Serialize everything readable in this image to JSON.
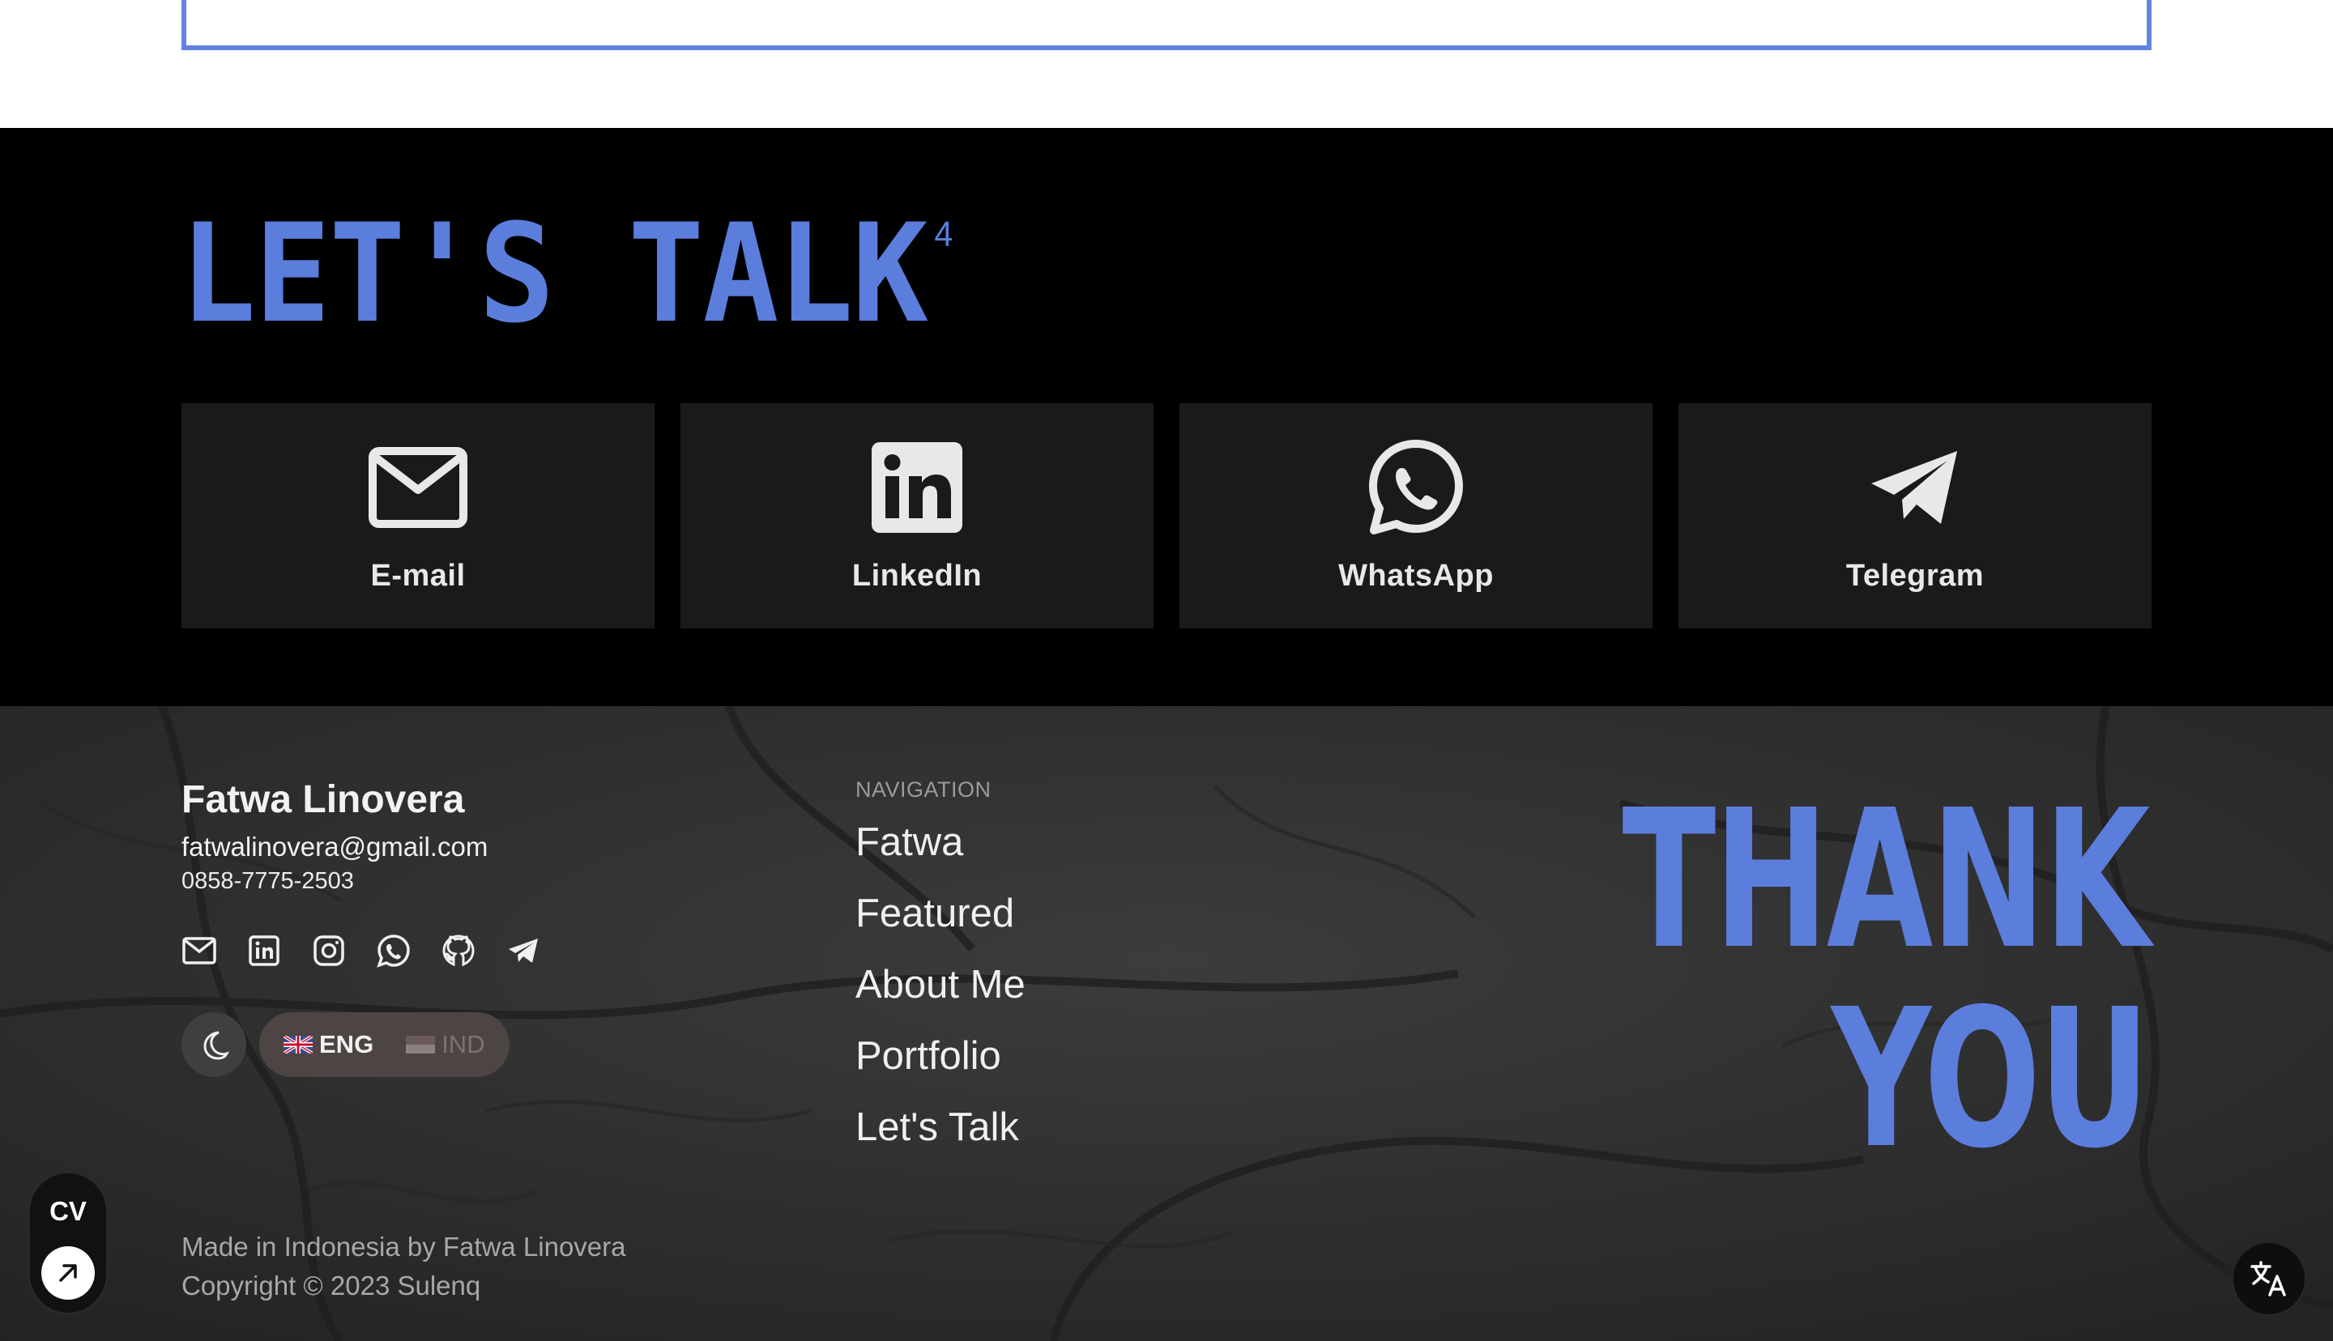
{
  "talk": {
    "title": "LET'S TALK",
    "title_sup": "4",
    "cards": [
      {
        "label": "E-mail",
        "icon": "mail-icon"
      },
      {
        "label": "LinkedIn",
        "icon": "linkedin-icon"
      },
      {
        "label": "WhatsApp",
        "icon": "whatsapp-icon"
      },
      {
        "label": "Telegram",
        "icon": "telegram-icon"
      }
    ]
  },
  "footer": {
    "name": "Fatwa Linovera",
    "email": "fatwalinovera@gmail.com",
    "phone": "0858-7775-2503",
    "socials": [
      "mail-icon",
      "linkedin-icon",
      "instagram-icon",
      "whatsapp-icon",
      "github-icon",
      "telegram-icon"
    ],
    "languages": [
      {
        "label": "ENG",
        "active": true
      },
      {
        "label": "IND",
        "active": false
      }
    ],
    "nav_heading": "NAVIGATION",
    "nav_items": [
      "Fatwa",
      "Featured",
      "About Me",
      "Portfolio",
      "Let's Talk"
    ],
    "thank_line1": "THANK",
    "thank_line2": "YOU",
    "made_in": "Made in Indonesia by Fatwa Linovera",
    "copyright": "Copyright © 2023 Sulenq"
  },
  "cv": {
    "label": "CV"
  },
  "colors": {
    "accent": "#5b7ddc",
    "card_bg": "#1a1a1a",
    "section_bg": "#000000"
  }
}
